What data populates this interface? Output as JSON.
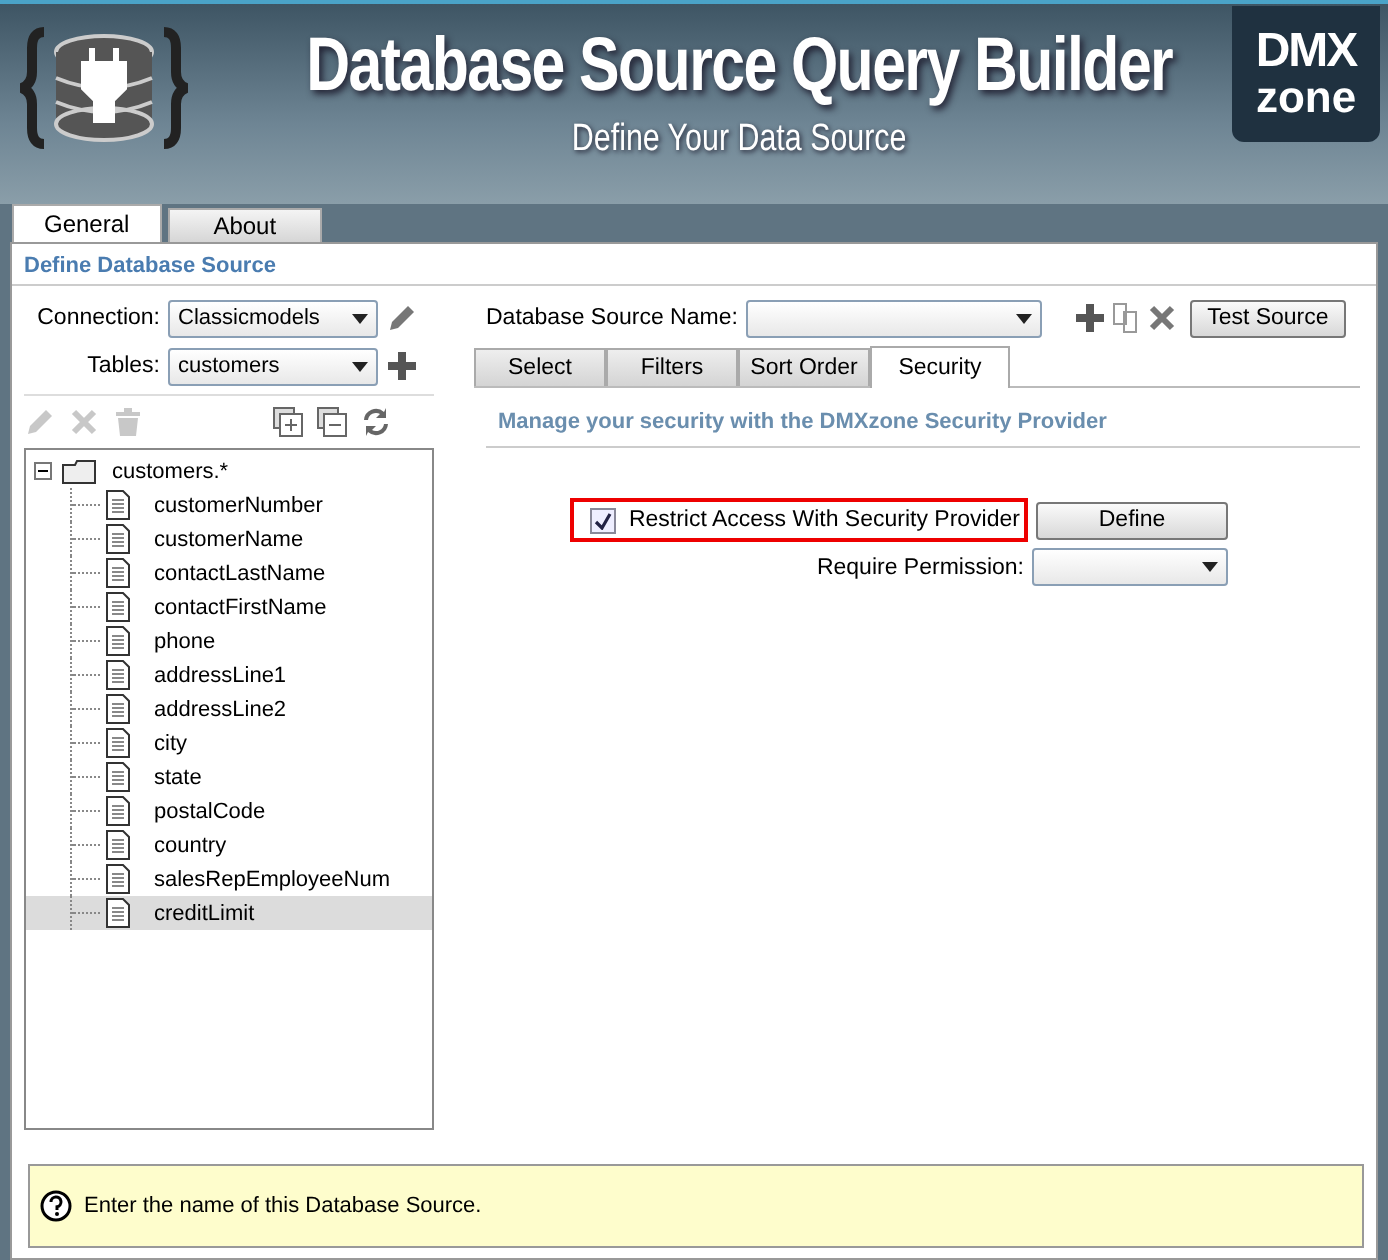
{
  "header": {
    "title": "Database Source Query Builder",
    "subtitle": "Define Your Data Source",
    "logo": {
      "line1": "DMX",
      "line2": "zone"
    }
  },
  "main_tabs": [
    {
      "label": "General",
      "selected": true
    },
    {
      "label": "About",
      "selected": false
    }
  ],
  "section_title": "Define Database Source",
  "connection": {
    "label": "Connection:",
    "value": "Classicmodels"
  },
  "tables": {
    "label": "Tables:",
    "value": "customers"
  },
  "tree_toolbar": [
    {
      "kind": "edit",
      "disabled": true
    },
    {
      "kind": "delete",
      "disabled": true
    },
    {
      "kind": "trash",
      "disabled": true
    },
    {
      "kind": "expand",
      "disabled": false
    },
    {
      "kind": "collapse",
      "disabled": false
    },
    {
      "kind": "refresh",
      "disabled": false
    }
  ],
  "tree": {
    "label": "customers.*",
    "expanded": true,
    "children": [
      {
        "label": "customerNumber",
        "selected": false
      },
      {
        "label": "customerName",
        "selected": false
      },
      {
        "label": "contactLastName",
        "selected": false
      },
      {
        "label": "contactFirstName",
        "selected": false
      },
      {
        "label": "phone",
        "selected": false
      },
      {
        "label": "addressLine1",
        "selected": false
      },
      {
        "label": "addressLine2",
        "selected": false
      },
      {
        "label": "city",
        "selected": false
      },
      {
        "label": "state",
        "selected": false
      },
      {
        "label": "postalCode",
        "selected": false
      },
      {
        "label": "country",
        "selected": false
      },
      {
        "label": "salesRepEmployeeNum",
        "selected": false
      },
      {
        "label": "creditLimit",
        "selected": true
      }
    ]
  },
  "source_name": {
    "label": "Database Source Name:"
  },
  "test_button": "Test Source",
  "sub_tabs": [
    {
      "label": "Select",
      "selected": false
    },
    {
      "label": "Filters",
      "selected": false
    },
    {
      "label": "Sort Order",
      "selected": false
    },
    {
      "label": "Security",
      "selected": true
    }
  ],
  "security": {
    "heading": "Manage your security with the DMXzone Security Provider",
    "restrict": {
      "label": "Restrict Access With Security Provider",
      "checked": true
    },
    "define_button": "Define",
    "permission_label": "Require Permission:"
  },
  "help": "Enter the name of this Database Source."
}
